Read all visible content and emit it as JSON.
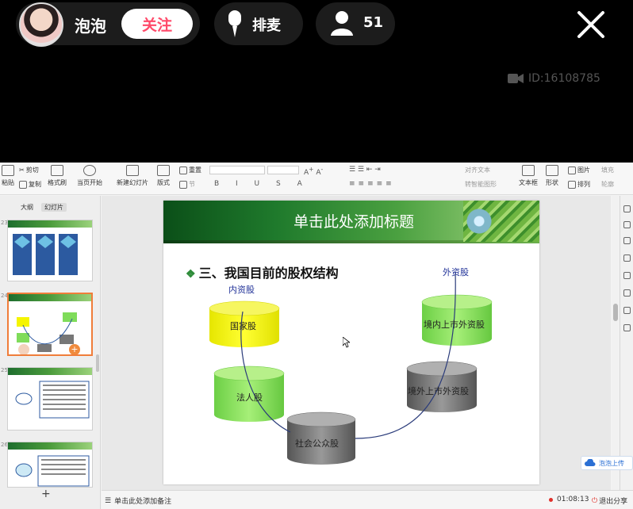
{
  "live": {
    "host_name": "泡泡",
    "follow_label": "关注",
    "mic_queue_label": "排麦",
    "viewer_count": "51",
    "room_id": "ID:16108785"
  },
  "ribbon": {
    "paste": "粘贴",
    "cut": "剪切",
    "copy": "复制",
    "format_painter": "格式刷",
    "play_from_current": "当页开始",
    "new_slide": "新建幻灯片",
    "layout": "版式",
    "section": "节",
    "reset": "重置",
    "text_box": "文本框",
    "shapes": "形状",
    "picture": "图片",
    "arrange": "排列",
    "fill": "填充",
    "outline": "轮廓",
    "smart_art": "转智能图形",
    "text_direction": "对齐文本",
    "colors": {
      "accent": "#2f8c3a",
      "live_follow": "#ff4a6a"
    }
  },
  "left_panel": {
    "tab_outline": "大纲",
    "tab_slides": "幻灯片",
    "thumbnails": [
      {
        "num": "23"
      },
      {
        "num": "24",
        "selected": true
      },
      {
        "num": "25"
      },
      {
        "num": "26"
      }
    ]
  },
  "slide": {
    "title": "单击此处添加标题",
    "subtitle": "三、我国目前的股权结构",
    "label_domestic": "内资股",
    "label_foreign": "外资股",
    "nodes": {
      "state": "国家股",
      "legal": "法人股",
      "public": "社会公众股",
      "b_share": "境内上市外资股",
      "h_share": "境外上市外资股"
    }
  },
  "float_upload": "泡泡上传",
  "status": {
    "notes": "单击此处添加备注",
    "recording_time": "01:08:13",
    "exit_share": "退出分享"
  }
}
